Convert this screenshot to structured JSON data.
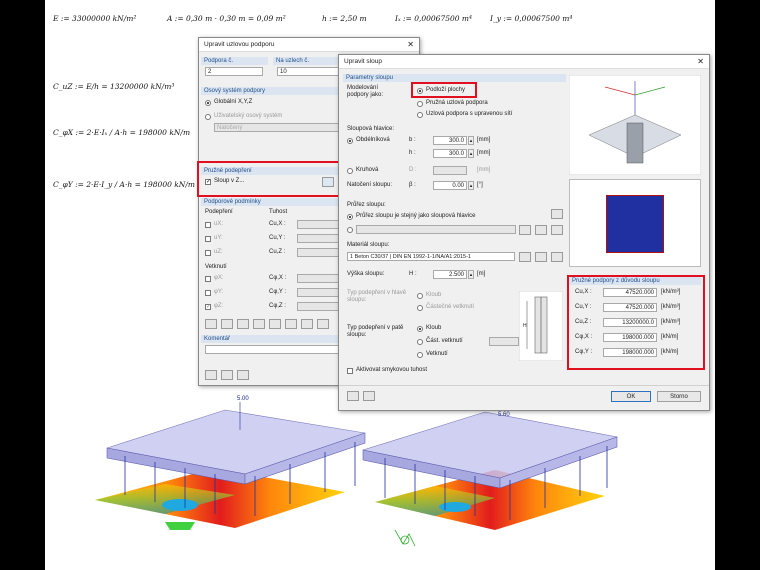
{
  "formulas": {
    "line1": {
      "E": "E := 33000000 kN/m²",
      "A": "A := 0,30 m · 0,30 m = 0,09 m²",
      "h": "h := 2,50 m",
      "Ix": "Iₓ := 0,00067500 m⁴",
      "Iy": "I_y := 0,00067500 m⁴"
    },
    "cuz": {
      "lhs": "C_uZ := E/h",
      "rhs": "= 13200000",
      "unit": "kN/m³"
    },
    "cphix": {
      "lhs": "C_φX := 2·E·Iₓ / A·h",
      "rhs": "= 198000",
      "unit": "kN/m"
    },
    "cphiy": {
      "lhs": "C_φY := 2·E·I_y / A·h",
      "rhs": "= 198000",
      "unit": "kN/m"
    }
  },
  "dialog_support": {
    "title": "Upravit uzlovou podporu",
    "support_no_label": "Podpora č.",
    "support_no_value": "2",
    "nodes_label": "Na uzlech č.",
    "nodes_value": "10",
    "axis_section": "Osový systém podpory",
    "global_axis": "Globální X,Y,Z",
    "user_axis": "Uživatelský osový systém",
    "rotated": "Natočený",
    "elastic_section": "Pružné podepření",
    "column_in_z": "Sloup v Z...",
    "conditions_section": "Podporové podmínky",
    "supported": "Podepření",
    "stiffness": "Tuhost",
    "uX": "uX:",
    "uY": "uY:",
    "uZ": "uZ:",
    "cuX": "Cu,X :",
    "cuY": "Cu,Y :",
    "cuZ": "Cu,Z :",
    "restraint": "Vetknutí",
    "phiX": "φX:",
    "phiY": "φY:",
    "phiZ": "φZ:",
    "cphiX": "Cφ,X :",
    "cphiY": "Cφ,Y :",
    "cphiZ": "Cφ,Z :",
    "comment": "Komentář"
  },
  "dialog_column": {
    "title": "Upravit sloup",
    "params_section": "Parametry sloupu",
    "modeling_label": "Modelování podpory jako:",
    "opt_surface": "Podloží plochy",
    "opt_elastic": "Pružná uzlová podpora",
    "opt_adjusted": "Uzlová podpora s upravenou sítí",
    "head_label": "Sloupová hlavice:",
    "rect": "Obdélníková",
    "round": "Kruhová",
    "b_label": "b :",
    "b_value": "300.0",
    "h_label": "h :",
    "h_value": "300.0",
    "d_label": "D :",
    "mm": "[mm]",
    "rotation_label": "Natočení sloupu:",
    "beta_label": "β :",
    "beta_value": "0.00",
    "deg": "[°]",
    "profile_label": "Průřez sloupu:",
    "profile_same": "Průřez sloupu je stejný jako sloupová hlavice",
    "material_label": "Materiál sloupu:",
    "material_value": "1   Beton C30/37  |  DIN EN 1992-1-1/NA/A1:2015-1",
    "height_label": "Výška sloupu:",
    "H_label": "H :",
    "H_value": "2.500",
    "m_unit": "[m]",
    "head_type_label": "Typ podepření v hlavě sloupu:",
    "hinge": "Kloub",
    "partial": "Částečné vetknutí",
    "foot_type_label": "Typ podepření v patě sloupu:",
    "foot_hinge": "Kloub",
    "foot_partial": "Část. vetknutí",
    "foot_fixed": "Vetknutí",
    "pct": "[%]",
    "shear": "Aktivovat smykovou tuhost",
    "ok": "OK",
    "cancel": "Storno",
    "result_section": "Pružné podpory z důvodu sloupu",
    "results": [
      {
        "label": "Cu,X :",
        "value": "47520.000",
        "unit": "[kN/m³]"
      },
      {
        "label": "Cu,Y :",
        "value": "47520.000",
        "unit": "[kN/m³]"
      },
      {
        "label": "Cu,Z :",
        "value": "13200000.0",
        "unit": "[kN/m³]"
      },
      {
        "label": "Cφ,X :",
        "value": "198000.000",
        "unit": "[kN/m]"
      },
      {
        "label": "Cφ,Y :",
        "value": "198000.000",
        "unit": "[kN/m]"
      }
    ]
  },
  "model_labels": {
    "left_load": "5.00",
    "right_load": "5.60"
  },
  "colors": {
    "highlight": "#e01020",
    "load": "#8080d0",
    "arrow": "#2030a0"
  }
}
